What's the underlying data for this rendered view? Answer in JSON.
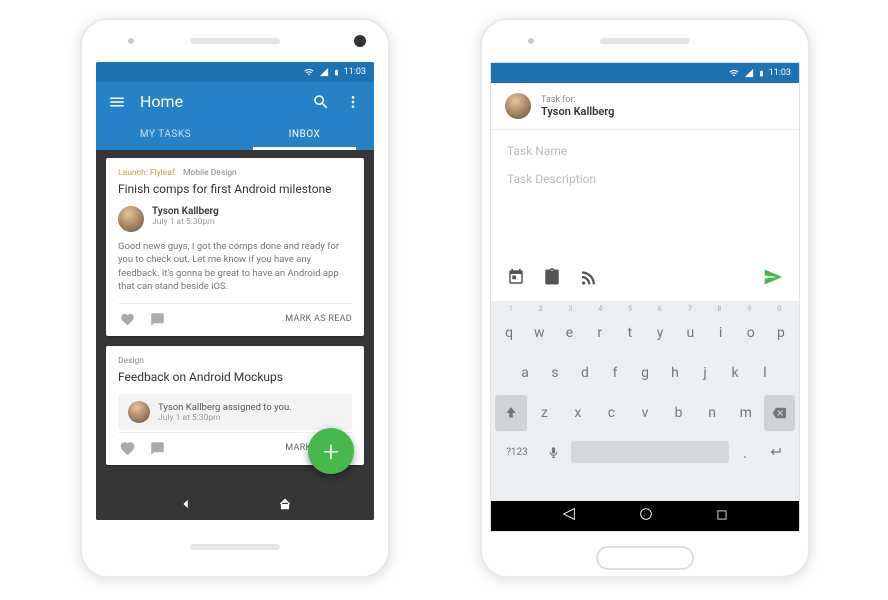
{
  "status": {
    "time": "11:03"
  },
  "phone1": {
    "header": {
      "title": "Home"
    },
    "tabs": [
      "MY TASKS",
      "INBOX"
    ],
    "active_tab": 1,
    "cards": [
      {
        "crumb1": "Launch: Flyleaf",
        "crumb2": "Mobile Design",
        "title": "Finish comps for first Android milestone",
        "author": "Tyson Kallberg",
        "date": "July 1 at 5:30pm",
        "body": "Good news guys, I got the comps done and ready for you to check out. Let me know if you have any feedback. It's gonna be great to have an Android app that can stand beside iOS.",
        "mark": "MARK AS READ"
      },
      {
        "crumb1": "",
        "crumb2": "Design",
        "title": "Feedback on Android Mockups",
        "assigned_text": "Tyson Kallberg assigned to you.",
        "date": "July 1 at 5:30pm",
        "mark": "MARK AS READ"
      }
    ]
  },
  "phone2": {
    "taskfor_label": "Task for:",
    "taskfor_name": "Tyson Kallberg",
    "placeholder_name": "Task Name",
    "placeholder_desc": "Task Description",
    "keyboard": {
      "nums": [
        "1",
        "2",
        "3",
        "4",
        "5",
        "6",
        "7",
        "8",
        "9",
        "0"
      ],
      "row1": [
        "q",
        "w",
        "e",
        "r",
        "t",
        "y",
        "u",
        "i",
        "o",
        "p"
      ],
      "row2": [
        "a",
        "s",
        "d",
        "f",
        "g",
        "h",
        "j",
        "k",
        "l"
      ],
      "row3": [
        "z",
        "x",
        "c",
        "v",
        "b",
        "n",
        "m"
      ],
      "sym": "?123"
    }
  }
}
